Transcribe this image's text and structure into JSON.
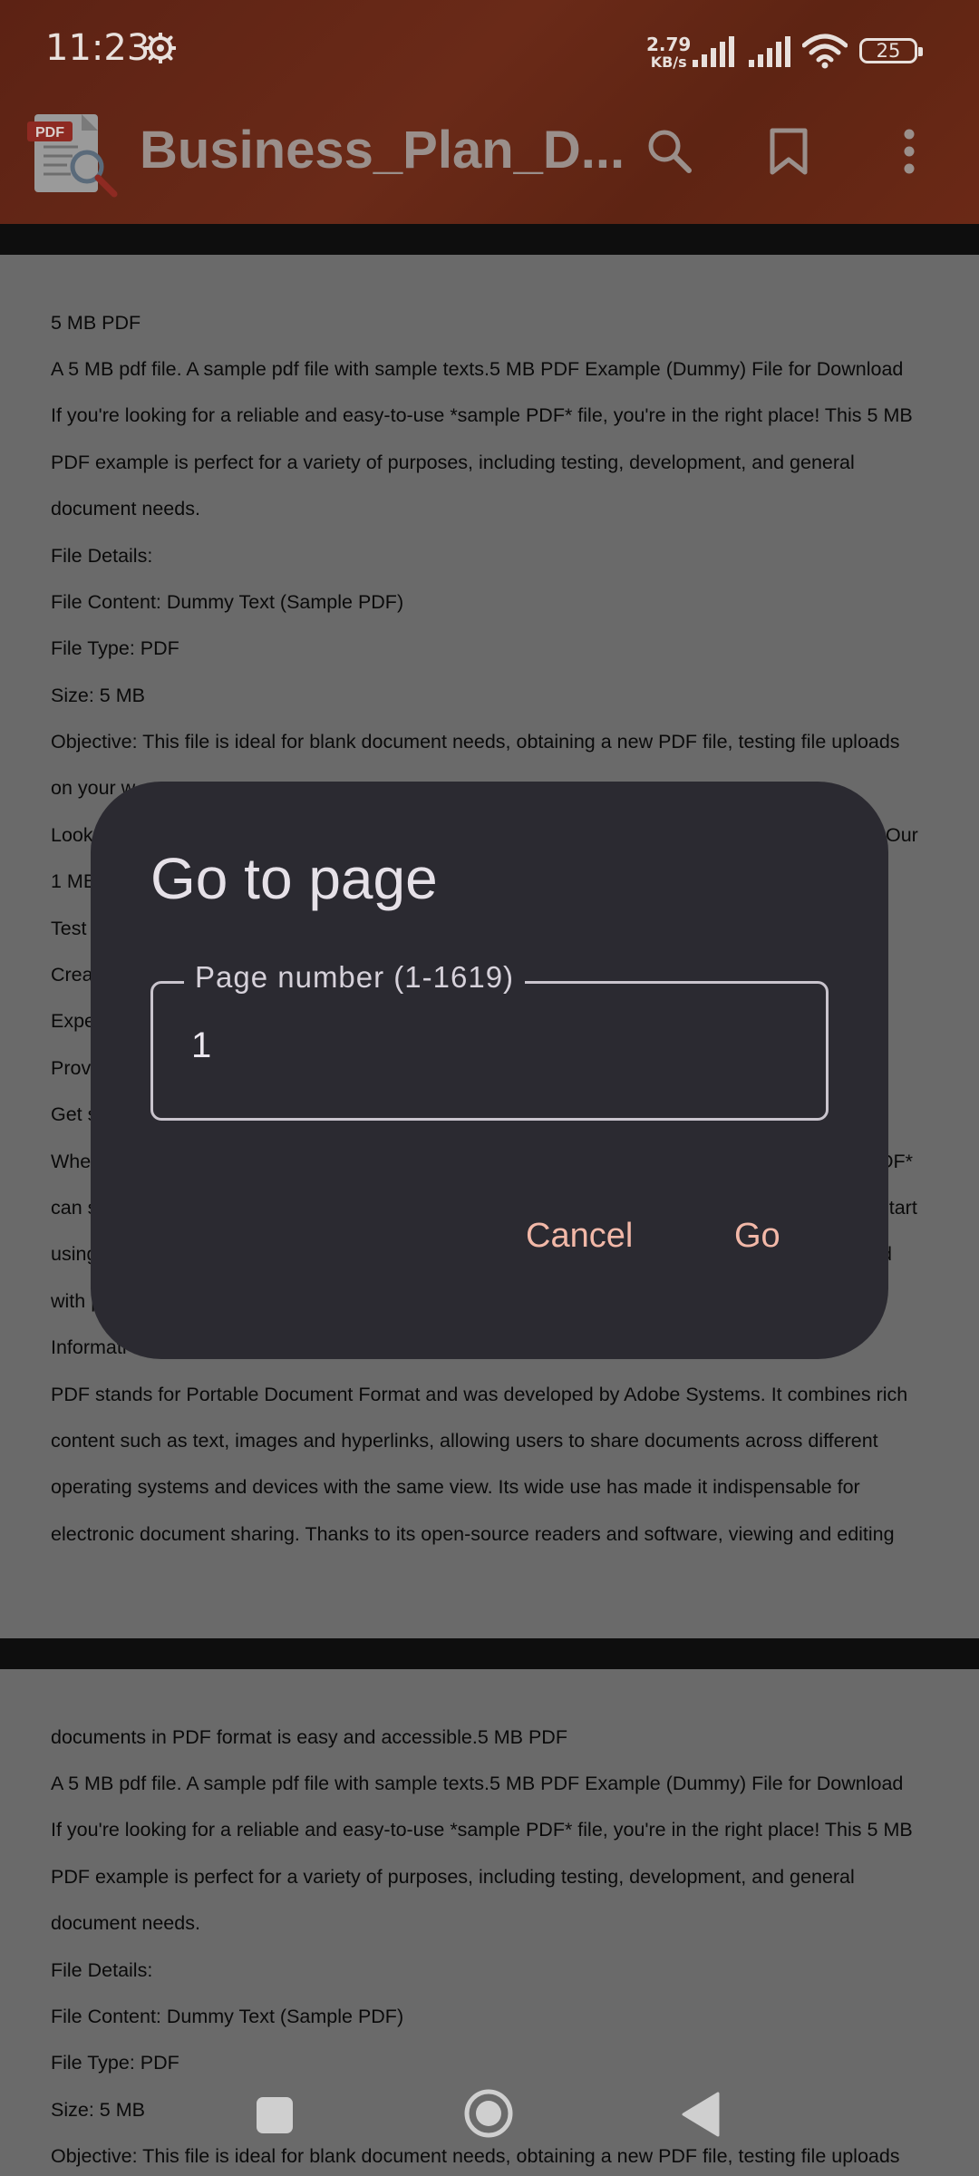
{
  "status_bar": {
    "time": "11:23",
    "net_speed_value": "2.79",
    "net_speed_unit": "KB/s",
    "battery": "25",
    "icons": [
      "gear-icon",
      "signal-icon",
      "signal-icon",
      "wifi-icon",
      "battery-icon"
    ]
  },
  "app_bar": {
    "title": "Business_Plan_D...",
    "logo_text": "PDF",
    "icons": [
      "search-icon",
      "bookmark-icon",
      "more-vert-icon"
    ]
  },
  "page1": {
    "lines": [
      "5 MB PDF",
      "A 5 MB pdf file. A sample pdf file with sample texts.5 MB PDF Example (Dummy) File for Download",
      "If you're looking for a reliable and easy-to-use *sample PDF* file, you're in the right place! This 5 MB",
      "PDF example is perfect for a variety of purposes, including testing, development, and general",
      "document needs.",
      "File Details:",
      "File Content: Dummy Text (Sample PDF)",
      "File Type: PDF",
      "Size: 5 MB",
      "Objective: This file is ideal for blank document needs, obtaining a new PDF file, testing file uploads",
      "on your w",
      "Look",
      "1 MB",
      "Test",
      "Crea",
      "Expe",
      "Prov",
      "Get s",
      "Whe",
      "can s",
      "using",
      "with p",
      "Informati",
      "PDF stands for Portable Document Format and was developed by Adobe Systems. It combines rich",
      "content such as text, images and hyperlinks, allowing users to share documents across different",
      "operating systems and devices with the same view. Its wide use has made it indispensable for",
      "electronic document sharing. Thanks to its open-source readers and software, viewing and editing"
    ],
    "right_fragments": [
      "Our",
      "DF*",
      "start",
      "d"
    ]
  },
  "page2": {
    "lines": [
      "documents in PDF format is easy and accessible.5 MB PDF",
      "A 5 MB pdf file. A sample pdf file with sample texts.5 MB PDF Example (Dummy) File for Download",
      "If you're looking for a reliable and easy-to-use *sample PDF* file, you're in the right place! This 5 MB",
      "PDF example is perfect for a variety of purposes, including testing, development, and general",
      "document needs.",
      "File Details:",
      "File Content: Dummy Text (Sample PDF)",
      "File Type: PDF",
      "Size: 5 MB",
      "Objective: This file is ideal for blank document needs, obtaining a new PDF file, testing file uploads"
    ]
  },
  "dialog": {
    "title": "Go to page",
    "field_label": "Page number (1-1619)",
    "field_value": "1",
    "cancel_label": "Cancel",
    "go_label": "Go"
  },
  "nav_bar": {
    "icons": [
      "recents-icon",
      "home-icon",
      "back-icon"
    ]
  }
}
